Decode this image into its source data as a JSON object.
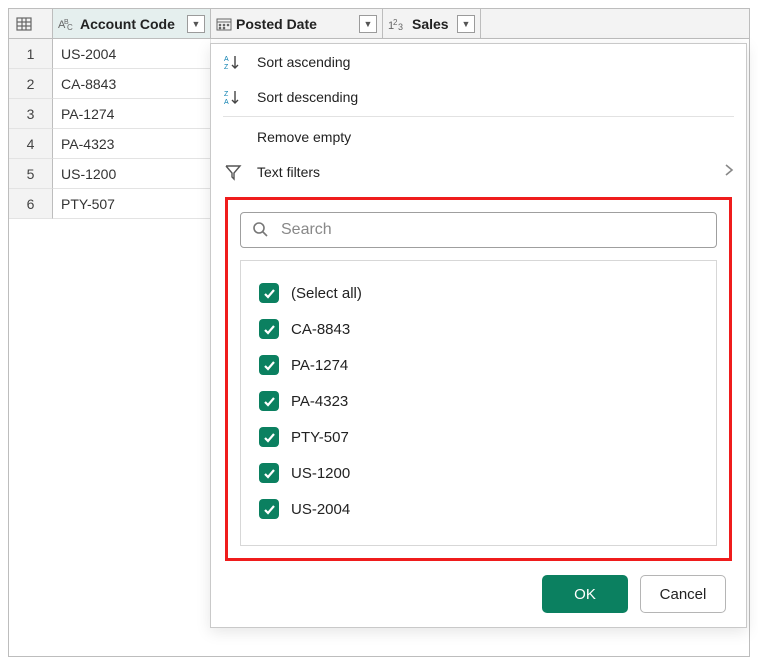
{
  "columns": {
    "account_code": {
      "label": "Account Code"
    },
    "posted_date": {
      "label": "Posted Date"
    },
    "sales": {
      "label": "Sales"
    }
  },
  "rows": [
    {
      "n": "1",
      "account_code": "US-2004"
    },
    {
      "n": "2",
      "account_code": "CA-8843"
    },
    {
      "n": "3",
      "account_code": "PA-1274"
    },
    {
      "n": "4",
      "account_code": "PA-4323"
    },
    {
      "n": "5",
      "account_code": "US-1200"
    },
    {
      "n": "6",
      "account_code": "PTY-507"
    }
  ],
  "menu": {
    "sort_asc": "Sort ascending",
    "sort_desc": "Sort descending",
    "remove_empty": "Remove empty",
    "text_filters": "Text filters"
  },
  "search": {
    "placeholder": "Search"
  },
  "filter_values": [
    {
      "label": "(Select all)",
      "checked": true
    },
    {
      "label": "CA-8843",
      "checked": true
    },
    {
      "label": "PA-1274",
      "checked": true
    },
    {
      "label": "PA-4323",
      "checked": true
    },
    {
      "label": "PTY-507",
      "checked": true
    },
    {
      "label": "US-1200",
      "checked": true
    },
    {
      "label": "US-2004",
      "checked": true
    }
  ],
  "buttons": {
    "ok": "OK",
    "cancel": "Cancel"
  }
}
